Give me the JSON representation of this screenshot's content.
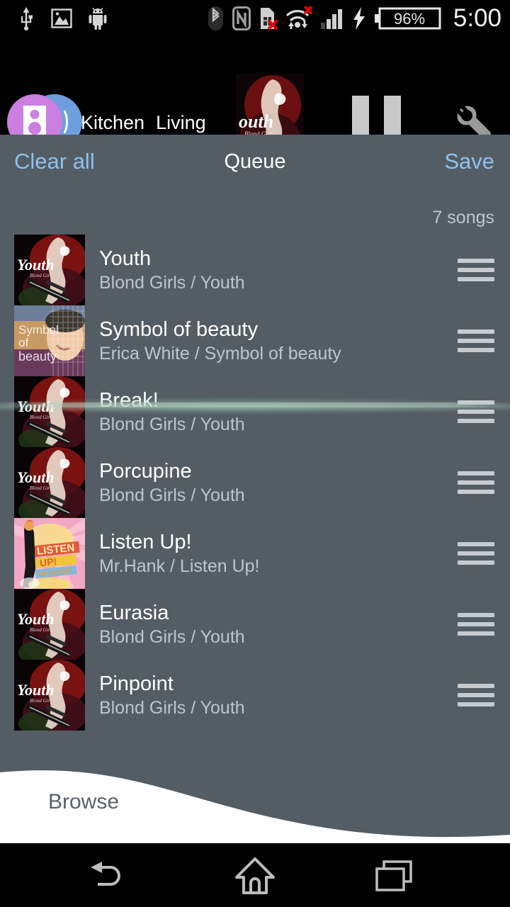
{
  "status_bar": {
    "left_icons": [
      "usb-icon",
      "image-icon",
      "android-robot-icon"
    ],
    "right_icons": [
      "bluetooth-icon",
      "nfc-icon",
      "sim-card-error-icon",
      "wifi-transfer-error-icon",
      "signal-bars-icon",
      "charging-bolt-icon"
    ],
    "battery_percent": "96%",
    "clock": "5:00"
  },
  "app_bar": {
    "speaker_icon": "speaker-group-icon",
    "rooms": [
      {
        "label": "Kitchen"
      },
      {
        "label": "Living"
      }
    ],
    "now_playing_art": "youth-album-art",
    "pause_button": "pause-icon",
    "settings_button": "wrench-icon",
    "colors": {
      "circle_front": "#cb7fe0",
      "circle_back": "#6e9ede",
      "pause": "#c9c9c9",
      "wrench": "#9a9a9a"
    }
  },
  "queue": {
    "clear_all_label": "Clear all",
    "title": "Queue",
    "save_label": "Save",
    "song_count": "7 songs",
    "accent_color": "#8ec2f0",
    "panel_color": "#545d64",
    "songs": [
      {
        "title": "Youth",
        "subtitle": "Blond Girls / Youth",
        "artwork": "youth-album-art",
        "drag_handle": "drag-handle-icon"
      },
      {
        "title": "Symbol of beauty",
        "subtitle": "Erica White / Symbol of beauty",
        "artwork": "symbol-of-beauty-album-art",
        "drag_handle": "drag-handle-icon"
      },
      {
        "title": "Break!",
        "subtitle": "Blond Girls / Youth",
        "artwork": "youth-album-art",
        "drag_handle": "drag-handle-icon"
      },
      {
        "title": "Porcupine",
        "subtitle": "Blond Girls / Youth",
        "artwork": "youth-album-art",
        "drag_handle": "drag-handle-icon"
      },
      {
        "title": "Listen Up!",
        "subtitle": "Mr.Hank / Listen Up!",
        "artwork": "listen-up-album-art",
        "drag_handle": "drag-handle-icon"
      },
      {
        "title": "Eurasia",
        "subtitle": "Blond Girls / Youth",
        "artwork": "youth-album-art",
        "drag_handle": "drag-handle-icon"
      },
      {
        "title": "Pinpoint",
        "subtitle": "Blond Girls / Youth",
        "artwork": "youth-album-art",
        "drag_handle": "drag-handle-icon"
      }
    ]
  },
  "browse": {
    "label": "Browse"
  },
  "nav_bar": {
    "back": "back-icon",
    "home": "home-icon",
    "recents": "recents-icon"
  }
}
